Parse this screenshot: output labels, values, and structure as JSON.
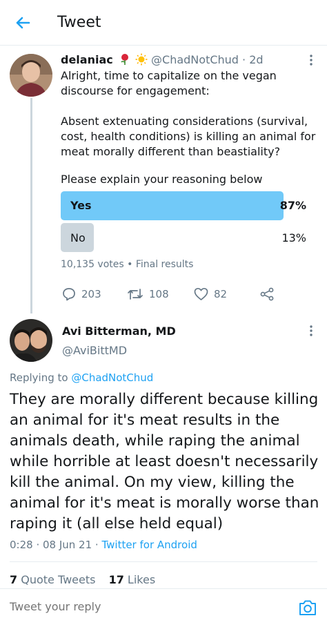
{
  "header": {
    "title": "Tweet",
    "back_icon": "arrow-left-icon"
  },
  "tweet1": {
    "display_name": "delaniac",
    "emoji": [
      "rose-icon",
      "sun-icon"
    ],
    "handle": "@ChadNotChud",
    "time": "· 2d",
    "text_lines": [
      "Alright, time to capitalize on the vegan discourse for engagement:",
      "Absent extenuating considerations (survival, cost, health conditions) is killing an animal for meat morally different than beastiality?",
      "Please explain your reasoning below"
    ],
    "poll": {
      "options": [
        {
          "label": "Yes",
          "percent_text": "87%",
          "share": 0.87,
          "color": "#71c9f8"
        },
        {
          "label": "No",
          "percent_text": "13%",
          "share": 0.13,
          "color": "#ccd6dd"
        }
      ],
      "meta": "10,135 votes • Final results"
    },
    "actions": {
      "replies": "203",
      "retweets": "108",
      "likes": "82"
    }
  },
  "tweet2": {
    "display_name": "Avi Bitterman, MD",
    "handle": "@AviBittMD",
    "replying_prefix": "Replying to ",
    "replying_handle": "@ChadNotChud",
    "body": "They are morally different because killing an animal for it's meat results in the animals death, while raping the animal while horrible at least doesn't necessarily kill the animal. On my view, killing the animal for it's meat is morally worse than raping it (all else held equal)",
    "timestamp": "0:28 · 08 Jun 21 · ",
    "client": "Twitter for Android",
    "quote_count": "7",
    "quote_label": " Quote Tweets",
    "like_count": "17",
    "like_label": " Likes"
  },
  "composer": {
    "placeholder": "Tweet your reply",
    "camera_icon": "camera-icon"
  },
  "colors": {
    "accent": "#1da1f2",
    "secondary_text": "#657786",
    "divider": "#e6ecf0"
  }
}
